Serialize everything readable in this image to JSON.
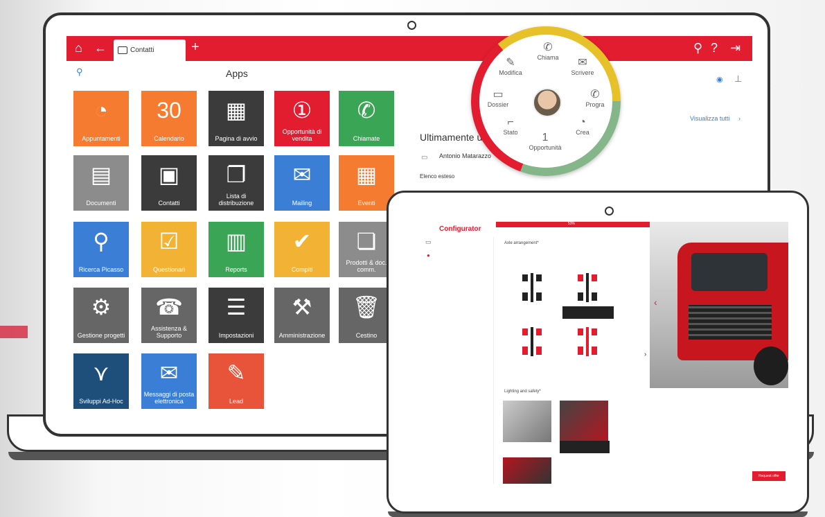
{
  "laptop": {
    "tab_label": "Contatti",
    "apps_title": "Apps",
    "tiles": [
      {
        "label": "Appuntamenti",
        "glyph": "◔",
        "color": "#f47b30"
      },
      {
        "label": "Calendario",
        "glyph": "30",
        "color": "#f47b30"
      },
      {
        "label": "Pagina di avvio",
        "glyph": "▦",
        "color": "#3b3b3b"
      },
      {
        "label": "Opportunità di vendita",
        "glyph": "①",
        "color": "#e31d30"
      },
      {
        "label": "Chiamate",
        "glyph": "✆",
        "color": "#3aa655"
      },
      {
        "label": "Documenti",
        "glyph": "▤",
        "color": "#8c8c8c"
      },
      {
        "label": "Contatti",
        "glyph": "▣",
        "color": "#3b3b3b"
      },
      {
        "label": "Lista di distribuzione",
        "glyph": "❐",
        "color": "#3b3b3b"
      },
      {
        "label": "Mailing",
        "glyph": "✉",
        "color": "#3a7fd5"
      },
      {
        "label": "Eventi",
        "glyph": "▦",
        "color": "#f47b30"
      },
      {
        "label": "Ricerca Picasso",
        "glyph": "⚲",
        "color": "#3a7fd5"
      },
      {
        "label": "Questionari",
        "glyph": "☑",
        "color": "#f2b233"
      },
      {
        "label": "Reports",
        "glyph": "▥",
        "color": "#3aa655"
      },
      {
        "label": "Compiti",
        "glyph": "✔",
        "color": "#f2b233"
      },
      {
        "label": "Prodotti & doc. comm.",
        "glyph": "❏",
        "color": "#8c8c8c"
      },
      {
        "label": "Gestione progetti",
        "glyph": "⚙",
        "color": "#666666"
      },
      {
        "label": "Assistenza & Supporto",
        "glyph": "☎",
        "color": "#666666"
      },
      {
        "label": "Impostazioni",
        "glyph": "☰",
        "color": "#3b3b3b"
      },
      {
        "label": "Amministrazione",
        "glyph": "⚒",
        "color": "#666666"
      },
      {
        "label": "Cestino",
        "glyph": "🗑",
        "color": "#666666"
      },
      {
        "label": "Sviluppi Ad-Hoc",
        "glyph": "⋎",
        "color": "#1e4f7a"
      },
      {
        "label": "Messaggi di posta elettronica",
        "glyph": "✉",
        "color": "#3a7fd5"
      },
      {
        "label": "Lead",
        "glyph": "✎",
        "color": "#e8543a"
      }
    ],
    "right": {
      "view_all": "Visualizza tutti",
      "recent_title": "Ultimamente u",
      "recent_name": "Antonio Matarazzo",
      "extended_list": "Elenco esteso"
    }
  },
  "radial_menu": {
    "items": [
      "Chiama",
      "Scrivere",
      "Progra",
      "Crea",
      "Opportunità",
      "Stato",
      "Dossier",
      "Modifica"
    ],
    "opportunity_badge": "1"
  },
  "tablet": {
    "title": "Configurator",
    "progress_label": "53%",
    "section_axle": "Axle arrangement*",
    "section_lighting": "Lighting and safety*",
    "select_button": "Request offer"
  }
}
